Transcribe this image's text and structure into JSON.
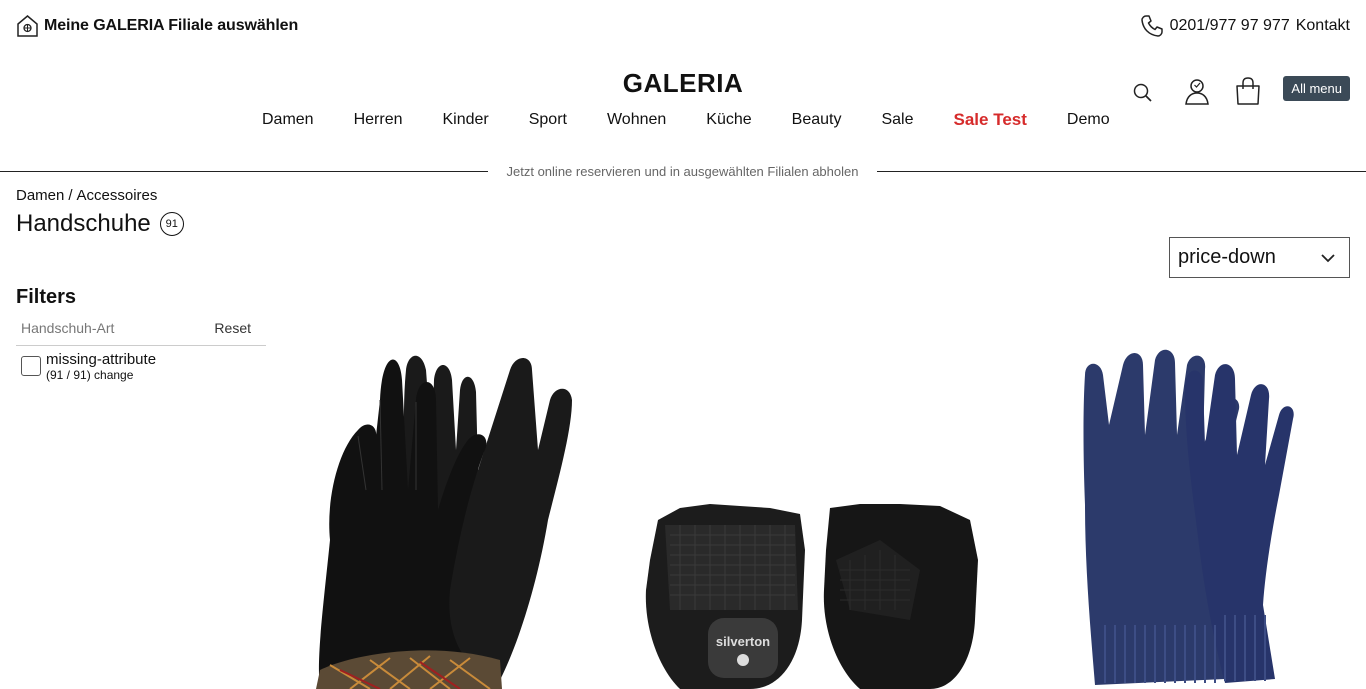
{
  "topbar": {
    "store_select_label": "Meine GALERIA Filiale auswählen",
    "store_icon": "store-location-icon",
    "phone_icon": "phone-icon",
    "phone": "0201/977 97 977",
    "contact_label": "Kontakt"
  },
  "logo": "GALERIA",
  "nav": {
    "items": [
      "Damen",
      "Herren",
      "Kinder",
      "Sport",
      "Wohnen",
      "Küche",
      "Beauty",
      "Sale",
      "Sale Test",
      "Demo"
    ],
    "accent_item": "Sale Test",
    "accent_color": "#d62b2b"
  },
  "header_actions": {
    "search_icon": "search-icon",
    "account_icon": "account-icon",
    "cart_icon": "shopping-bag-icon",
    "all_menu_label": "All menu",
    "all_menu_color": "#3b4a57"
  },
  "banner": "Jetzt online reservieren und in ausgewählten Filialen abholen",
  "breadcrumb": {
    "parent": "Damen",
    "separator": "/",
    "current": "Accessoires"
  },
  "page": {
    "title": "Handschuhe",
    "count": "91"
  },
  "sort": {
    "selected": "price-down",
    "icon": "chevron-down-icon"
  },
  "filters": {
    "title": "Filters",
    "group_name": "Handschuh-Art",
    "reset_label": "Reset",
    "options": [
      {
        "label": "missing-attribute",
        "meta": "(91 / 91) change",
        "checked": false
      }
    ]
  },
  "products": [
    {
      "image": "black-leather-gloves-with-plaid-cuff"
    },
    {
      "image": "black-fingerless-cycling-gloves",
      "brand_text": "silverton"
    },
    {
      "image": "navy-knit-gloves"
    }
  ]
}
